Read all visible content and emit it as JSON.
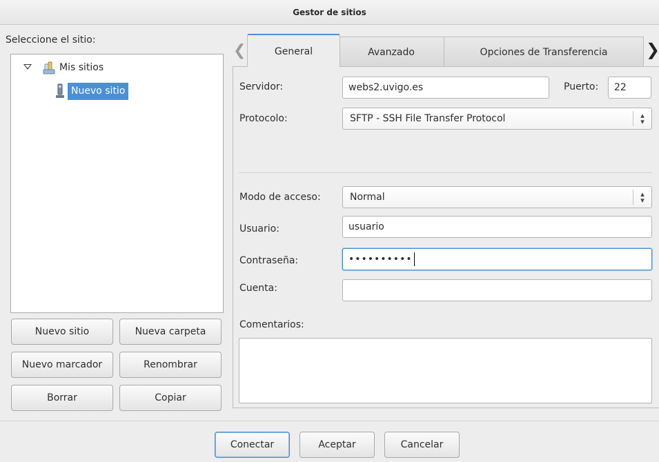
{
  "window": {
    "title": "Gestor de sitios"
  },
  "left": {
    "select_label": "Seleccione el sitio:",
    "tree": {
      "root": "Mis sitios",
      "child": "Nuevo sitio"
    },
    "buttons": {
      "new_site": "Nuevo sitio",
      "new_folder": "Nueva carpeta",
      "new_bookmark": "Nuevo marcador",
      "rename": "Renombrar",
      "delete": "Borrar",
      "copy": "Copiar"
    }
  },
  "tabs": [
    {
      "label": "General",
      "active": true
    },
    {
      "label": "Avanzado",
      "active": false
    },
    {
      "label": "Opciones de Transferencia",
      "active": false
    }
  ],
  "form": {
    "server_label": "Servidor:",
    "server_value": "webs2.uvigo.es",
    "port_label": "Puerto:",
    "port_value": "22",
    "protocol_label": "Protocolo:",
    "protocol_value": "SFTP - SSH File Transfer Protocol",
    "access_label": "Modo de acceso:",
    "access_value": "Normal",
    "user_label": "Usuario:",
    "user_value": "usuario",
    "password_label": "Contraseña:",
    "password_value": "••••••••••",
    "account_label": "Cuenta:",
    "account_value": "",
    "comments_label": "Comentarios:"
  },
  "footer": {
    "connect": "Conectar",
    "accept": "Aceptar",
    "cancel": "Cancelar"
  },
  "icons": {
    "left_arrow": "chevron-left-icon",
    "right_arrow": "chevron-right-icon",
    "combo_arrows": "up-down-arrows-icon",
    "folder": "folder-icon",
    "site": "site-icon"
  },
  "colors": {
    "accent": "#4a90d9",
    "selection_text": "#ffffff"
  }
}
